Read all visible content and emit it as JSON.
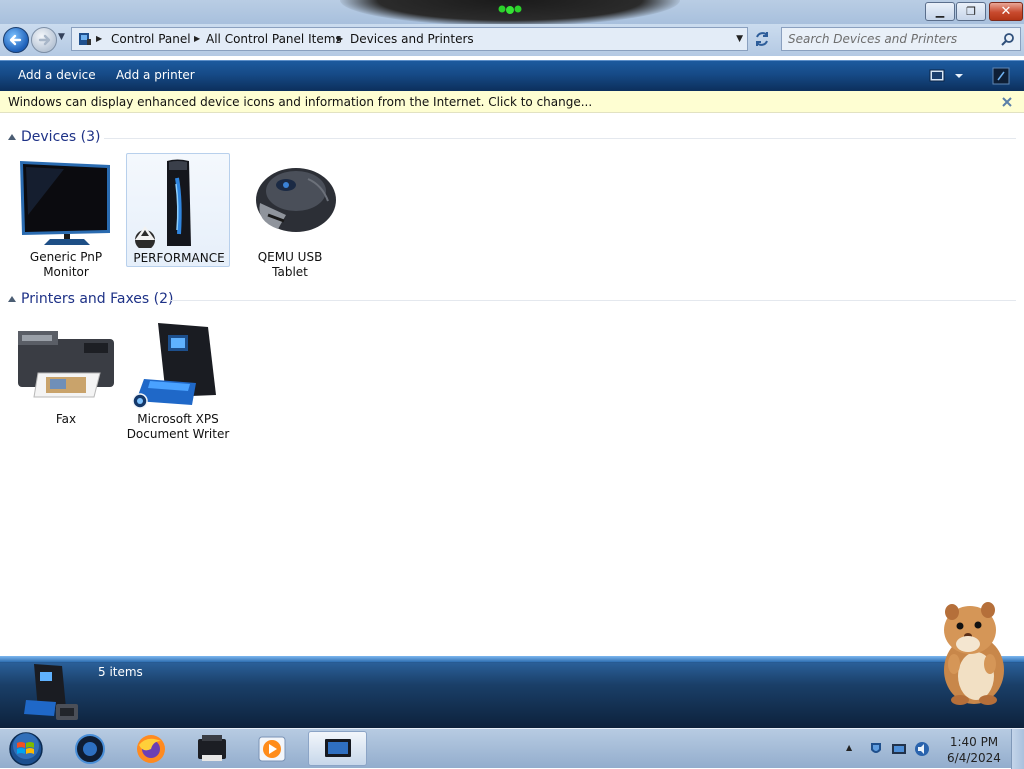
{
  "window": {
    "controls": {
      "minimize_icon": "minimize-icon",
      "maximize_icon": "restore-icon",
      "close_icon": "close-icon"
    }
  },
  "address": {
    "breadcrumbs": [
      "Control Panel",
      "All Control Panel Items",
      "Devices and Printers"
    ],
    "search_placeholder": "Search Devices and Printers"
  },
  "toolbar": {
    "add_device_label": "Add a device",
    "add_printer_label": "Add a printer"
  },
  "infobar": {
    "text": "Windows can display enhanced device icons and information from the Internet. Click to change..."
  },
  "groups": [
    {
      "title": "Devices (3)",
      "items": [
        {
          "label": "Generic PnP Monitor",
          "icon": "monitor-icon"
        },
        {
          "label": "PERFORMANCE",
          "icon": "computer-tower-icon",
          "selected": true
        },
        {
          "label": "QEMU USB Tablet",
          "icon": "mouse-icon"
        }
      ]
    },
    {
      "title": "Printers and Faxes (2)",
      "items": [
        {
          "label": "Fax",
          "icon": "fax-printer-icon"
        },
        {
          "label": "Microsoft XPS Document Writer",
          "icon": "xps-printer-icon"
        }
      ]
    }
  ],
  "status": {
    "count": "5 items"
  },
  "taskbar": {
    "apps": [
      "start-orb",
      "media-center",
      "firefox",
      "printer",
      "media-player",
      "devices-and-printers"
    ],
    "clock": {
      "time": "1:40 PM",
      "date": "6/4/2024"
    }
  },
  "colors": {
    "toolbar": "#164a86",
    "infobar": "#fefed2",
    "group_title": "#1e3287"
  }
}
